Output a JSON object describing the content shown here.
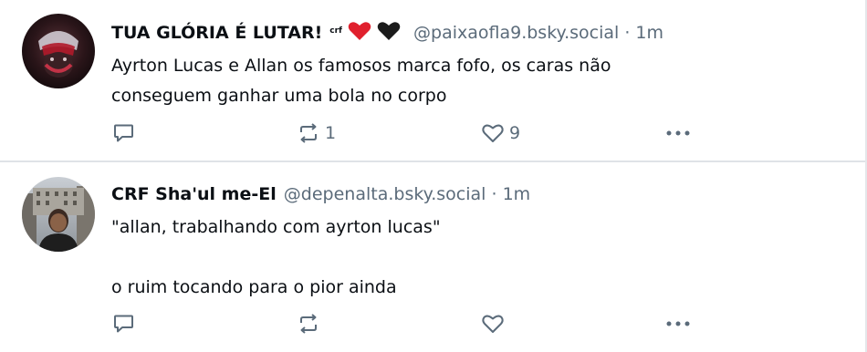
{
  "posts": [
    {
      "author": "TUA GLÓRIA É LUTAR!",
      "badge": "crf",
      "handle": "@paixaofla9.bsky.social",
      "separator": "·",
      "time": "1m",
      "text": "Ayrton Lucas e Allan os famosos marca fofo, os caras não\nconseguem ganhar uma bola no corpo",
      "reply_count": "",
      "repost_count": "1",
      "like_count": "9"
    },
    {
      "author": "CRF Sha'ul me-El",
      "handle": "@depenalta.bsky.social",
      "separator": "·",
      "time": "1m",
      "text": "\"allan, trabalhando com ayrton lucas\"\n\no ruim tocando para o pior ainda",
      "reply_count": "",
      "repost_count": "",
      "like_count": ""
    }
  ],
  "icons": {
    "reply": "reply-icon",
    "repost": "repost-icon",
    "like": "heart-icon",
    "more": "more-options-icon"
  },
  "colors": {
    "muted": "#5b6b7a",
    "text": "#0b0f14",
    "divider": "#dfe3e7",
    "red_heart": "#e0202d"
  }
}
